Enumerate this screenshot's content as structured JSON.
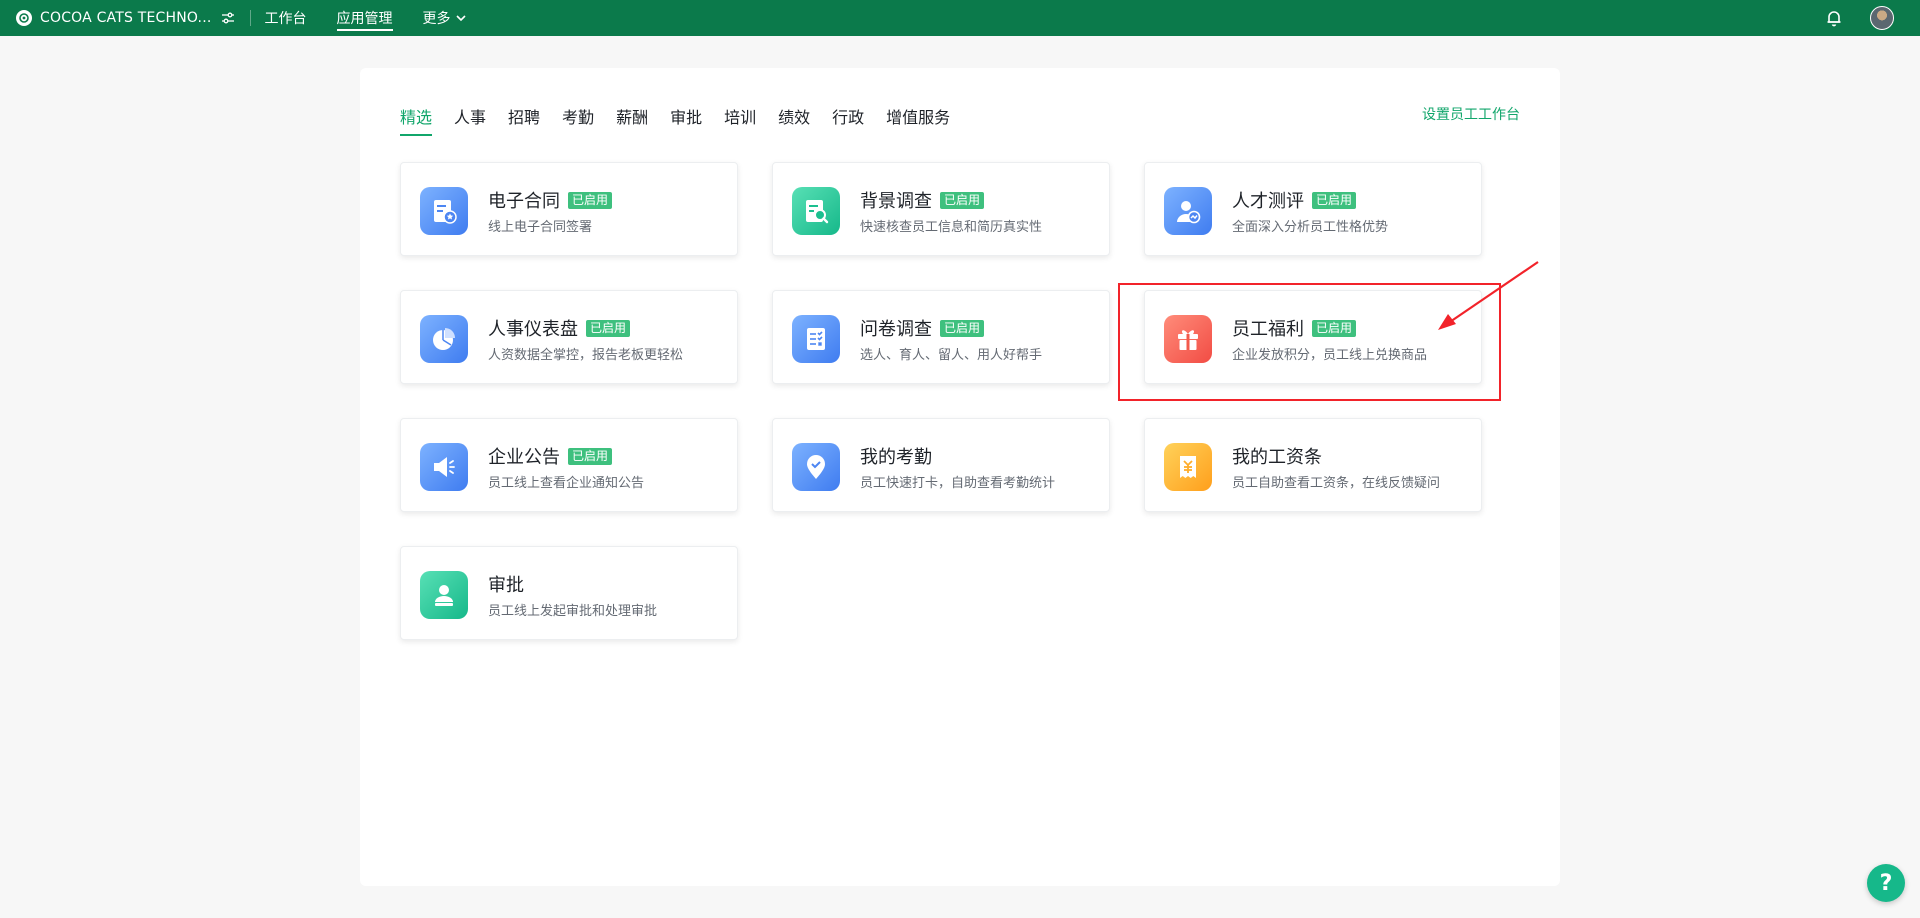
{
  "topbar": {
    "company_name": "COCOA CATS TECHNO...",
    "nav": [
      {
        "label": "工作台"
      },
      {
        "label": "应用管理"
      },
      {
        "label": "更多"
      }
    ],
    "brand_color": "#0b7a4b"
  },
  "tabs": [
    {
      "label": "精选"
    },
    {
      "label": "人事"
    },
    {
      "label": "招聘"
    },
    {
      "label": "考勤"
    },
    {
      "label": "薪酬"
    },
    {
      "label": "审批"
    },
    {
      "label": "培训"
    },
    {
      "label": "绩效"
    },
    {
      "label": "行政"
    },
    {
      "label": "增值服务"
    }
  ],
  "active_tab": "精选",
  "set_link": "设置员工工作台",
  "cards": [
    {
      "title": "电子合同",
      "badge": "已启用",
      "desc": "线上电子合同签署",
      "icon": "contract-icon"
    },
    {
      "title": "背景调查",
      "badge": "已启用",
      "desc": "快速核查员工信息和简历真实性",
      "icon": "background-check-icon"
    },
    {
      "title": "人才测评",
      "badge": "已启用",
      "desc": "全面深入分析员工性格优势",
      "icon": "talent-assessment-icon"
    },
    {
      "title": "人事仪表盘",
      "badge": "已启用",
      "desc": "人资数据全掌控，报告老板更轻松",
      "icon": "pie-chart-icon"
    },
    {
      "title": "问卷调查",
      "badge": "已启用",
      "desc": "选人、育人、留人、用人好帮手",
      "icon": "survey-icon"
    },
    {
      "title": "员工福利",
      "badge": "已启用",
      "desc": "企业发放积分，员工线上兑换商品",
      "icon": "gift-icon"
    },
    {
      "title": "企业公告",
      "badge": "已启用",
      "desc": "员工线上查看企业通知公告",
      "icon": "megaphone-icon"
    },
    {
      "title": "我的考勤",
      "badge": "",
      "desc": "员工快速打卡，自助查看考勤统计",
      "icon": "location-check-icon"
    },
    {
      "title": "我的工资条",
      "badge": "",
      "desc": "员工自助查看工资条，在线反馈疑问",
      "icon": "payslip-icon"
    },
    {
      "title": "审批",
      "badge": "",
      "desc": "员工线上发起审批和处理审批",
      "icon": "approval-icon"
    }
  ],
  "help_label": "?",
  "accent_color": "#11a66b",
  "badge_color": "#3ec07e"
}
